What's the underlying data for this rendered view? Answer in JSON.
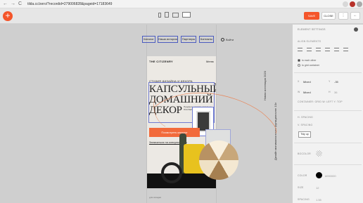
{
  "browser": {
    "url": "tilda.cc/zero/?recordid=279006828&pageid=17183649",
    "nav_back": "←",
    "nav_forward": "→",
    "nav_reload": "C"
  },
  "toolbar": {
    "add_label": "+",
    "save_label": "SAVE",
    "close_label": "CLOSE",
    "more_label": "⋮",
    "collapse_label": "←"
  },
  "site": {
    "nav_items": [
      "Каталог",
      "Наша история",
      "Партнеры",
      "Контакты"
    ],
    "login_label": "Войти",
    "vertical_right": "Новая коллекция 2020",
    "vertical_left": "Дизайн минималистичен функционален 10л",
    "brand": "THE CITIZENRY",
    "menu_label": "Меню",
    "subtitle": "СТУДИЯ ДИЗАЙНА И ДЕКОРА",
    "headline_1": "КАПСУЛЬНЫЙ",
    "headline_2": "ДОМАШНИЙ",
    "headline_3": "ДЕКОР",
    "small_text": "Предметы декора, интерьер, ПОСТЕРЫ И ГРАФИКА ...",
    "cta_label": "Посмотреть каталог",
    "link_label": "Записаться на консультацию",
    "bottom_text": "для соседки"
  },
  "panel": {
    "header": "ELEMENT SETTINGS",
    "align_label": "ALIGN ELEMENTS",
    "radio_each": "to each other",
    "radio_grid": "to grid container",
    "x_label": "X",
    "x_mode": "Mixed",
    "y_label": "Y",
    "y_value": "-35",
    "w_label": "W",
    "w_mode": "Mixed",
    "h_label": "H",
    "h_value": "36",
    "container_note": "CONTAINER: GRID  W: LEFT  Y: TOP",
    "h_spacing": "H. SPACING",
    "v_spacing": "V. SPACING",
    "tidy_label": "Tidy up",
    "bgcolor_label": "BGCOLOR",
    "color_label": "COLOR",
    "color_value": "#000000",
    "size_label": "SIZE",
    "size_value": "12",
    "spacing_label": "SPACING",
    "spacing_value": "1.55"
  },
  "colors": {
    "accent": "#f4552a",
    "cta": "#f26a3b",
    "selection": "#4b5bbf"
  }
}
